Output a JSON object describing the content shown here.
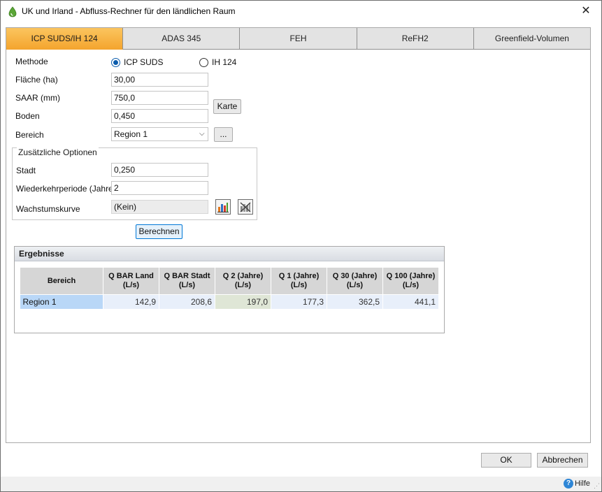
{
  "window": {
    "title": "UK und Irland - Abfluss-Rechner für den ländlichen Raum",
    "close_glyph": "✕",
    "app_icon": "droplet-icon"
  },
  "tabs": [
    {
      "label": "ICP SUDS/IH 124",
      "active": true
    },
    {
      "label": "ADAS 345",
      "active": false
    },
    {
      "label": "FEH",
      "active": false
    },
    {
      "label": "ReFH2",
      "active": false
    },
    {
      "label": "Greenfield-Volumen",
      "active": false
    }
  ],
  "form": {
    "methode_label": "Methode",
    "methode_options": [
      {
        "label": "ICP SUDS",
        "checked": true
      },
      {
        "label": "IH 124",
        "checked": false
      }
    ],
    "flaeche_label": "Fläche (ha)",
    "flaeche_value": "30,00",
    "saar_label": "SAAR (mm)",
    "saar_value": "750,0",
    "boden_label": "Boden",
    "boden_value": "0,450",
    "karte_button": "Karte",
    "bereich_label": "Bereich",
    "bereich_value": "Region 1",
    "ellipsis_button": "..."
  },
  "options": {
    "title": "Zusätzliche Optionen",
    "stadt_label": "Stadt",
    "stadt_value": "0,250",
    "wiederkehr_label": "Wiederkehrperiode (Jahre)",
    "wiederkehr_value": "2",
    "wachstum_label": "Wachstumskurve",
    "wachstum_value": "(Kein)",
    "chart_icon": "bar-chart-icon",
    "clear_icon": "clear-chart-icon"
  },
  "berechnen_button": "Berechnen",
  "results": {
    "title": "Ergebnisse",
    "columns": [
      "Bereich",
      "Q BAR Land (L/s)",
      "Q BAR Stadt (L/s)",
      "Q 2 (Jahre) (L/s)",
      "Q 1 (Jahre) (L/s)",
      "Q 30 (Jahre) (L/s)",
      "Q 100 (Jahre) (L/s)"
    ],
    "columns_line1": [
      "Bereich",
      "Q BAR Land",
      "Q BAR Stadt",
      "Q 2 (Jahre)",
      "Q 1 (Jahre)",
      "Q 30 (Jahre)",
      "Q 100 (Jahre)"
    ],
    "columns_line2": [
      "",
      "(L/s)",
      "(L/s)",
      "(L/s)",
      "(L/s)",
      "(L/s)",
      "(L/s)"
    ],
    "rows": [
      [
        "Region 1",
        "142,9",
        "208,6",
        "197,0",
        "177,3",
        "362,5",
        "441,1"
      ]
    ]
  },
  "footer": {
    "ok_button": "OK",
    "cancel_button": "Abbrechen",
    "help_label": "Hilfe"
  },
  "colors": {
    "active_tab": "#f4a52f",
    "selected_row": "#b9d7f7",
    "highlight_cell": "#dfe6d6"
  }
}
